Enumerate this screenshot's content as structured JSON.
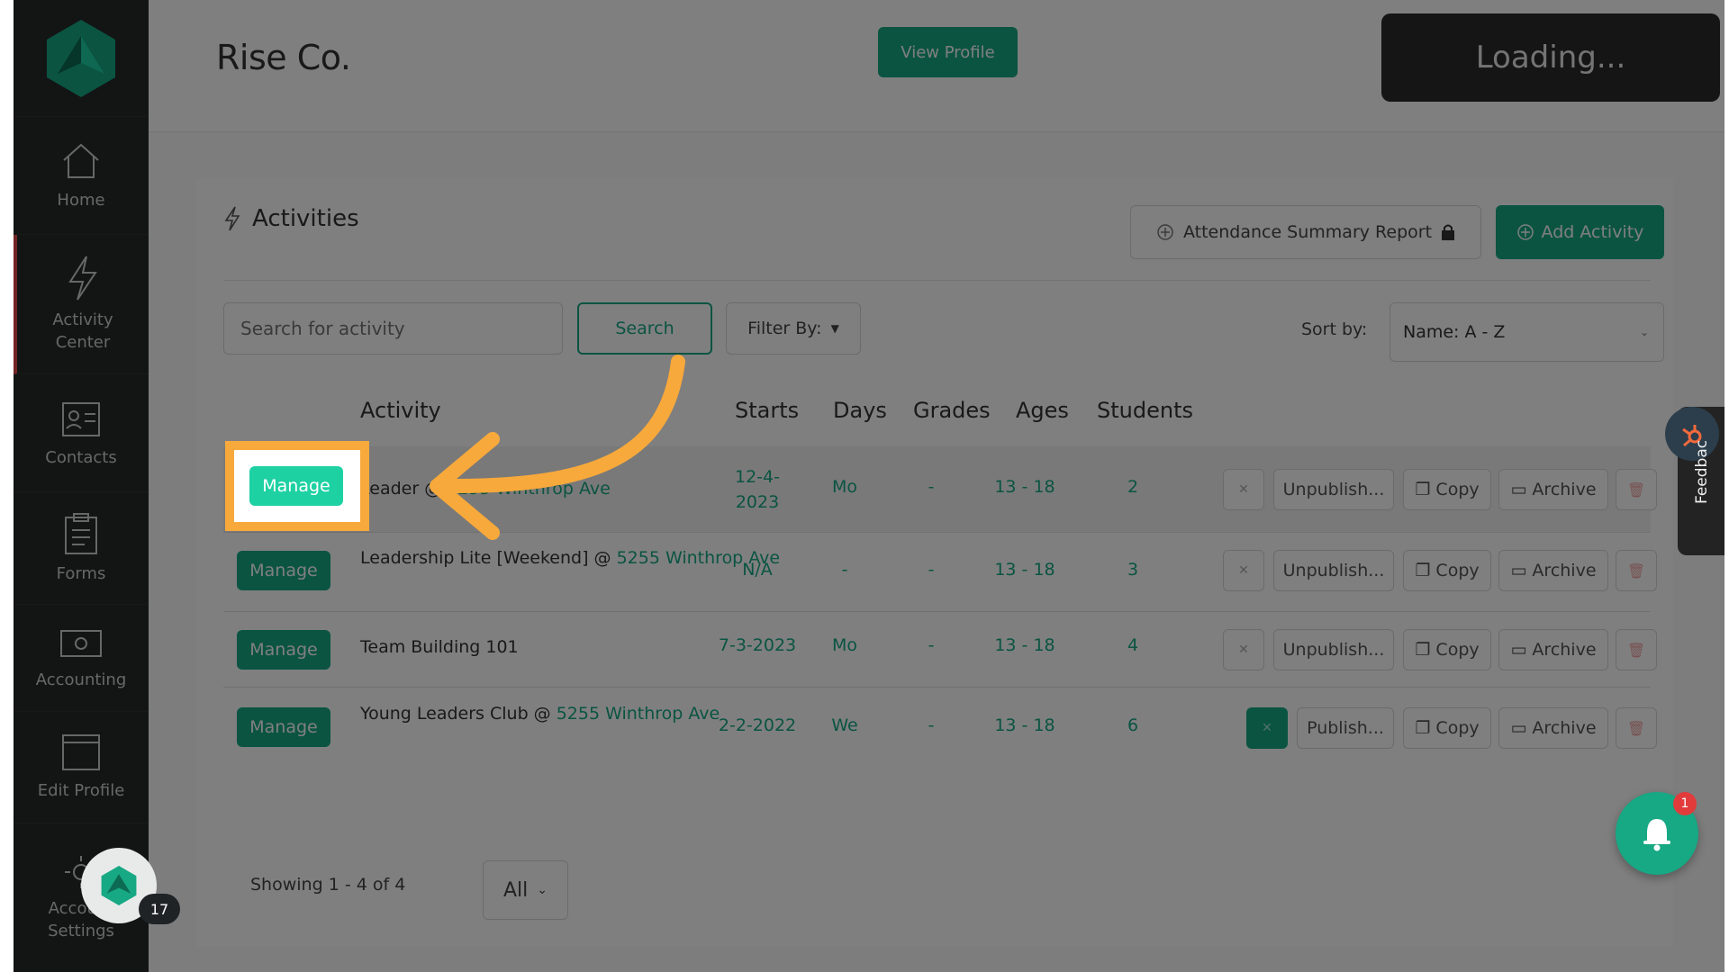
{
  "header": {
    "company": "Rise Co.",
    "view_profile": "View Profile",
    "loading": "Loading..."
  },
  "sidebar": {
    "items": [
      {
        "label": "Home",
        "icon": "home-icon"
      },
      {
        "label": "Activity Center",
        "icon": "lightning-icon"
      },
      {
        "label": "Contacts",
        "icon": "contacts-icon"
      },
      {
        "label": "Forms",
        "icon": "forms-icon"
      },
      {
        "label": "Accounting",
        "icon": "accounting-icon"
      },
      {
        "label": "Edit Profile",
        "icon": "profile-window-icon"
      },
      {
        "label": "Account Settings",
        "icon": "gear-icon"
      }
    ],
    "chat_badge": "17"
  },
  "panel": {
    "title": "Activities",
    "attendance_report": "Attendance Summary Report",
    "add_activity": "Add Activity",
    "search_placeholder": "Search for activity",
    "search_button": "Search",
    "filter_by": "Filter By:",
    "sort_label": "Sort by:",
    "sort_value": "Name: A - Z"
  },
  "table": {
    "columns": [
      "Activity",
      "Starts",
      "Days",
      "Grades",
      "Ages",
      "Students"
    ],
    "manage_label": "Manage",
    "copy_label": "Copy",
    "archive_label": "Archive",
    "rows": [
      {
        "name": "Leader",
        "location": "5255 Winthrop Ave",
        "starts": "12-4-2023",
        "days": "Mo",
        "grades": "-",
        "ages": "13 - 18",
        "students": "2",
        "publish": "Unpublish...",
        "pinned": false
      },
      {
        "name": "Leadership Lite [Weekend] @ ",
        "location": "5255 Winthrop Ave",
        "starts": "N/A",
        "days": "-",
        "grades": "-",
        "ages": "13 - 18",
        "students": "3",
        "publish": "Unpublish...",
        "pinned": false
      },
      {
        "name": "Team Building 101",
        "location": "",
        "starts": "7-3-2023",
        "days": "Mo",
        "grades": "-",
        "ages": "13 - 18",
        "students": "4",
        "publish": "Unpublish...",
        "pinned": false
      },
      {
        "name": "Young Leaders Club @ ",
        "location": "5255 Winthrop Ave",
        "starts": "2-2-2022",
        "days": "We",
        "grades": "-",
        "ages": "13 - 18",
        "students": "6",
        "publish": "Publish...",
        "pinned": true
      }
    ]
  },
  "footer": {
    "showing": "Showing 1 - 4 of 4",
    "per_page": "All"
  },
  "widgets": {
    "feedback": "Feedbac",
    "notification_count": "1"
  },
  "colors": {
    "accent": "#17a884",
    "highlight": "#f8a93b",
    "sidebar": "#262a2b"
  }
}
